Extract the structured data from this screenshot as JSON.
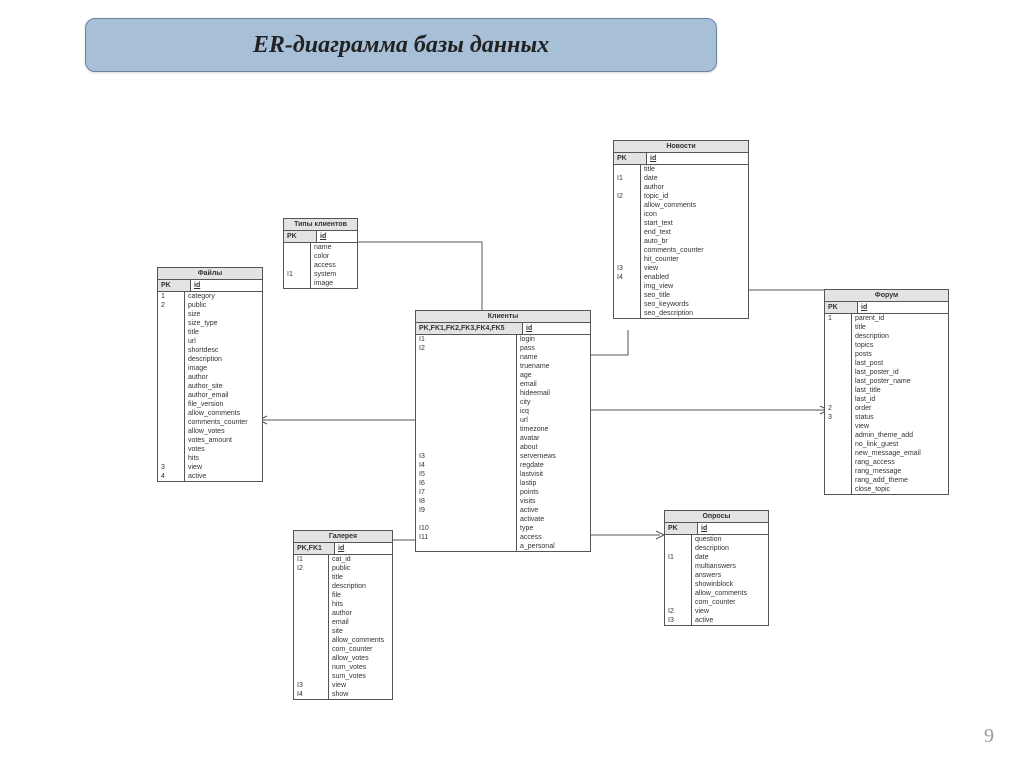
{
  "title": "ER-диаграмма базы данных",
  "page_number": "9",
  "entities": {
    "types": {
      "name": "Типы клиентов",
      "pk_label": "PK",
      "pk_field": "id",
      "rows": [
        {
          "k": "",
          "v": "name"
        },
        {
          "k": "",
          "v": "color"
        },
        {
          "k": "",
          "v": "access"
        },
        {
          "k": "I1",
          "v": "system"
        },
        {
          "k": "",
          "v": "image"
        }
      ]
    },
    "files": {
      "name": "Файлы",
      "pk_label": "PK",
      "pk_field": "id",
      "rows": [
        {
          "k": "1",
          "v": "category"
        },
        {
          "k": "2",
          "v": "public"
        },
        {
          "k": "",
          "v": "size"
        },
        {
          "k": "",
          "v": "size_type"
        },
        {
          "k": "",
          "v": "title"
        },
        {
          "k": "",
          "v": "url"
        },
        {
          "k": "",
          "v": "shortdesc"
        },
        {
          "k": "",
          "v": "description"
        },
        {
          "k": "",
          "v": "image"
        },
        {
          "k": "",
          "v": "author"
        },
        {
          "k": "",
          "v": "author_site"
        },
        {
          "k": "",
          "v": "author_email"
        },
        {
          "k": "",
          "v": "file_version"
        },
        {
          "k": "",
          "v": "allow_comments"
        },
        {
          "k": "",
          "v": "comments_counter"
        },
        {
          "k": "",
          "v": "allow_votes"
        },
        {
          "k": "",
          "v": "votes_amount"
        },
        {
          "k": "",
          "v": "votes"
        },
        {
          "k": "",
          "v": "hits"
        },
        {
          "k": "3",
          "v": "view"
        },
        {
          "k": "4",
          "v": "active"
        }
      ]
    },
    "gallery": {
      "name": "Галерея",
      "pk_label": "PK,FK1",
      "pk_field": "id",
      "rows": [
        {
          "k": "I1",
          "v": "cat_id"
        },
        {
          "k": "I2",
          "v": "public"
        },
        {
          "k": "",
          "v": "title"
        },
        {
          "k": "",
          "v": "description"
        },
        {
          "k": "",
          "v": "file"
        },
        {
          "k": "",
          "v": "hits"
        },
        {
          "k": "",
          "v": "author"
        },
        {
          "k": "",
          "v": "email"
        },
        {
          "k": "",
          "v": "site"
        },
        {
          "k": "",
          "v": "allow_comments"
        },
        {
          "k": "",
          "v": "com_counter"
        },
        {
          "k": "",
          "v": "allow_votes"
        },
        {
          "k": "",
          "v": "num_votes"
        },
        {
          "k": "",
          "v": "sum_votes"
        },
        {
          "k": "I3",
          "v": "view"
        },
        {
          "k": "I4",
          "v": "show"
        }
      ]
    },
    "clients": {
      "name": "Клиенты",
      "pk_label": "PK,FK1,FK2,FK3,FK4,FK5",
      "pk_field": "id",
      "rows": [
        {
          "k": "I1",
          "v": "login"
        },
        {
          "k": "I2",
          "v": "pass"
        },
        {
          "k": "",
          "v": "name"
        },
        {
          "k": "",
          "v": "truename"
        },
        {
          "k": "",
          "v": "age"
        },
        {
          "k": "",
          "v": "email"
        },
        {
          "k": "",
          "v": "hideemail"
        },
        {
          "k": "",
          "v": "city"
        },
        {
          "k": "",
          "v": "icq"
        },
        {
          "k": "",
          "v": "url"
        },
        {
          "k": "",
          "v": "timezone"
        },
        {
          "k": "",
          "v": "avatar"
        },
        {
          "k": "",
          "v": "about"
        },
        {
          "k": "I3",
          "v": "servernews"
        },
        {
          "k": "I4",
          "v": "regdate"
        },
        {
          "k": "I5",
          "v": "lastvisit"
        },
        {
          "k": "I6",
          "v": "lastip"
        },
        {
          "k": "I7",
          "v": "points"
        },
        {
          "k": "I8",
          "v": "visits"
        },
        {
          "k": "I9",
          "v": "active"
        },
        {
          "k": "",
          "v": "activate"
        },
        {
          "k": "I10",
          "v": "type"
        },
        {
          "k": "I11",
          "v": "access"
        },
        {
          "k": "",
          "v": "a_personal"
        }
      ]
    },
    "news": {
      "name": "Новости",
      "pk_label": "PK",
      "pk_field": "id",
      "rows": [
        {
          "k": "",
          "v": "title"
        },
        {
          "k": "I1",
          "v": "date"
        },
        {
          "k": "",
          "v": "author"
        },
        {
          "k": "I2",
          "v": "topic_id"
        },
        {
          "k": "",
          "v": "allow_comments"
        },
        {
          "k": "",
          "v": "icon"
        },
        {
          "k": "",
          "v": "start_text"
        },
        {
          "k": "",
          "v": "end_text"
        },
        {
          "k": "",
          "v": "auto_br"
        },
        {
          "k": "",
          "v": "comments_counter"
        },
        {
          "k": "",
          "v": "hit_counter"
        },
        {
          "k": "I3",
          "v": "view"
        },
        {
          "k": "I4",
          "v": "enabled"
        },
        {
          "k": "",
          "v": "img_view"
        },
        {
          "k": "",
          "v": "seo_title"
        },
        {
          "k": "",
          "v": "seo_keywords"
        },
        {
          "k": "",
          "v": "seo_description"
        }
      ]
    },
    "polls": {
      "name": "Опросы",
      "pk_label": "PK",
      "pk_field": "id",
      "rows": [
        {
          "k": "",
          "v": "question"
        },
        {
          "k": "",
          "v": "description"
        },
        {
          "k": "I1",
          "v": "date"
        },
        {
          "k": "",
          "v": "multianswers"
        },
        {
          "k": "",
          "v": "answers"
        },
        {
          "k": "",
          "v": "showinblock"
        },
        {
          "k": "",
          "v": "allow_comments"
        },
        {
          "k": "",
          "v": "com_counter"
        },
        {
          "k": "I2",
          "v": "view"
        },
        {
          "k": "I3",
          "v": "active"
        }
      ]
    },
    "forum": {
      "name": "Форум",
      "pk_label": "PK",
      "pk_field": "id",
      "rows": [
        {
          "k": "1",
          "v": "parent_id"
        },
        {
          "k": "",
          "v": "title"
        },
        {
          "k": "",
          "v": "description"
        },
        {
          "k": "",
          "v": "topics"
        },
        {
          "k": "",
          "v": "posts"
        },
        {
          "k": "",
          "v": "last_post"
        },
        {
          "k": "",
          "v": "last_poster_id"
        },
        {
          "k": "",
          "v": "last_poster_name"
        },
        {
          "k": "",
          "v": "last_title"
        },
        {
          "k": "",
          "v": "last_id"
        },
        {
          "k": "2",
          "v": "order"
        },
        {
          "k": "3",
          "v": "status"
        },
        {
          "k": "",
          "v": "view"
        },
        {
          "k": "",
          "v": "admin_theme_add"
        },
        {
          "k": "",
          "v": "no_link_guest"
        },
        {
          "k": "",
          "v": "new_message_email"
        },
        {
          "k": "",
          "v": "rang_access"
        },
        {
          "k": "",
          "v": "rang_message"
        },
        {
          "k": "",
          "v": "rang_add_theme"
        },
        {
          "k": "",
          "v": "close_topic"
        }
      ]
    }
  }
}
